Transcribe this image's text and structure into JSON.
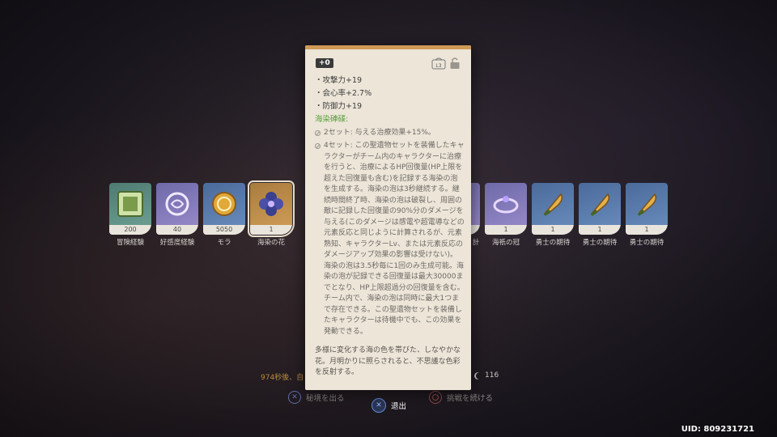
{
  "items": [
    {
      "label": "冒険経験",
      "count": "200",
      "icon": "adventure-exp-book-icon",
      "rarity": "r2"
    },
    {
      "label": "好感度経験",
      "count": "40",
      "icon": "companionship-exp-icon",
      "rarity": "r4"
    },
    {
      "label": "モラ",
      "count": "5050",
      "icon": "mora-coin-icon",
      "rarity": "r3"
    },
    {
      "label": "海染の花",
      "count": "1",
      "icon": "flower-artifact-icon",
      "rarity": "r5"
    },
    {
      "label": "計",
      "count": "1",
      "icon": "artifact-icon",
      "rarity": "r4"
    },
    {
      "label": "海祇の冠",
      "count": "1",
      "icon": "circlet-artifact-icon",
      "rarity": "r4"
    },
    {
      "label": "勇士の期待",
      "count": "1",
      "icon": "quill-artifact-icon",
      "rarity": "r3"
    },
    {
      "label": "勇士の期待",
      "count": "1",
      "icon": "quill-artifact-icon",
      "rarity": "r3"
    },
    {
      "label": "勇士の期待",
      "count": "1",
      "icon": "quill-artifact-icon",
      "rarity": "r3"
    }
  ],
  "tooltip": {
    "level": "+0",
    "lock_icon": "lock-icon",
    "lock_key": "L3",
    "stats": [
      "・攻撃力+19",
      "・会心率+2.7%",
      "・防御力+19"
    ],
    "set_name": "海染硨磲:",
    "effects": [
      "2セット: 与える治療効果+15%。",
      "4セット: この聖遺物セットを装備したキャラクターがチーム内のキャラクターに治療を行うと、治療によるHP回復量(HP上限を超えた回復量も含む)を記録する海染の泡を生成する。海染の泡は3秒継続する。継続時間終了時、海染の泡は破裂し、周囲の敵に記録した回復量の90%分のダメージを与える(このダメージは感電や超電導などの元素反応と同じように計算されるが、元素熟知、キャラクターLv、または元素反応のダメージアップ効果の影響は受けない)。海染の泡は3.5秒毎に1回のみ生成可能。海染の泡が記録できる回復量は最大30000までとなり、HP上限超過分の回復量を含む。チーム内で、海染の泡は同時に最大1つまで存在できる。この聖遺物セットを装備したキャラクターは待機中でも、この効果を発動できる。"
    ],
    "description": "多様に変化する海の色を帯びた、しなやかな花。月明かりに照らされると、不思議な色彩を反射する。"
  },
  "footer": {
    "timer": "974秒後、自",
    "resin": "116",
    "leave_label": "秘境を出る",
    "exit_label": "退出",
    "continue_label": "挑戦を続ける",
    "uid": "UID: 809231721"
  },
  "colors": {
    "accent": "#cf9a56",
    "set_green": "#5aa13c",
    "tooltip_bg": "#ece5d8"
  }
}
